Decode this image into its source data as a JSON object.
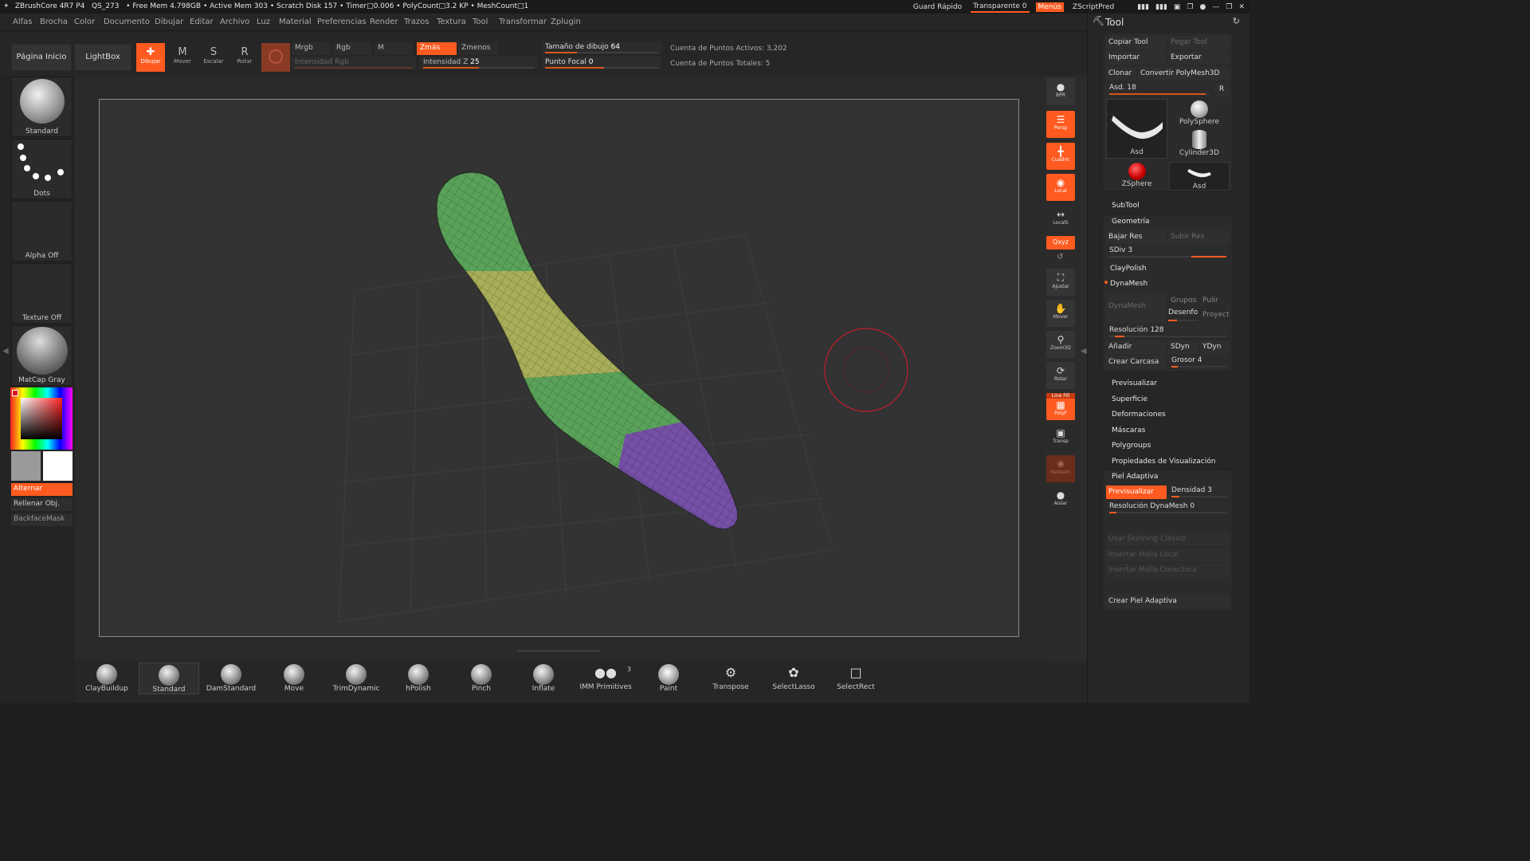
{
  "titlebar": {
    "app": "ZBrushCore 4R7 P4",
    "file": "QS_273",
    "free_mem": "• Free Mem 4.798GB",
    "active_mem": "• Active Mem 303",
    "scratch": "• Scratch Disk 157 •",
    "timer": "Timer□0.006",
    "polycount": "• PolyCount□3.2 KP",
    "meshcount": "• MeshCount□1",
    "quicksave": "Guard Rápido",
    "transparent": "Transparente 0",
    "menus": "Menús",
    "script": "ZScriptPred"
  },
  "menubar": [
    "Alfas",
    "Brocha",
    "Color",
    "Documento",
    "Dibujar",
    "Editar",
    "Archivo",
    "Luz",
    "Material",
    "Preferencias",
    "Render",
    "Trazos",
    "Textura",
    "Tool",
    "Transformar",
    "Zplugin"
  ],
  "shelf": {
    "home": "Página Inicio",
    "lightbox": "LightBox",
    "draw": "Dibujar",
    "move": "Mover",
    "scale": "Escalar",
    "rotate": "Rotar",
    "mrgb": "Mrgb",
    "rgb": "Rgb",
    "m": "M",
    "zadd": "Zmás",
    "zsub": "Zmenos",
    "rgb_intensity": "Intensidad Rgb",
    "z_intensity": "Intensidad Z",
    "z_intensity_value": "25",
    "draw_size": "Tamaño de dibujo",
    "draw_size_value": "64",
    "focal": "Punto Focal",
    "focal_value": "0",
    "active_points": "Cuenta de Puntos Activos: 3,202",
    "total_points": "Cuenta de Puntos Totales: 5"
  },
  "left": {
    "brush": "Standard",
    "stroke": "Dots",
    "alpha": "Alpha Off",
    "texture": "Texture Off",
    "material": "MatCap Gray",
    "alternate": "Alternar",
    "fill": "Rellenar Obj.",
    "backface": "BackfaceMask"
  },
  "rightbar": {
    "bpr": "BPR",
    "persp": "Persp",
    "floor": "Cuadric",
    "local": "Local",
    "locals": "LocalS",
    "xyz": "Qxyz",
    "frame": "Ajustar",
    "move": "Mover",
    "zoom": "Zoom3D",
    "rotate": "Rotar",
    "linefill": "Line Fill",
    "polyf": "PolyF",
    "transp": "Transp",
    "ghost": "Fantasm",
    "solo": "Aislar"
  },
  "brushes": [
    {
      "label": "ClayBuildup"
    },
    {
      "label": "Standard"
    },
    {
      "label": "DamStandard"
    },
    {
      "label": "Move"
    },
    {
      "label": "TrimDynamic"
    },
    {
      "label": "hPolish"
    },
    {
      "label": "Pinch"
    },
    {
      "label": "Inflate"
    },
    {
      "label": "IMM Primitives",
      "badge": "3"
    },
    {
      "label": "Paint"
    },
    {
      "label": "Transpose"
    },
    {
      "label": "SelectLasso"
    },
    {
      "label": "SelectRect"
    }
  ],
  "tool": {
    "title": "Tool",
    "copy": "Copiar Tool",
    "paste": "Pegar Tool",
    "import": "Importar",
    "export": "Exportar",
    "clone": "Clonar",
    "convert": "Convertir PolyMesh3D",
    "asd": "Asd.",
    "asd_value": "18",
    "r": "R",
    "thumbs": [
      "Asd",
      "PolySphere",
      "Cylinder3D",
      "ZSphere",
      "Asd"
    ],
    "subtool": "SubTool",
    "geometry": "Geometría",
    "lower_res": "Bajar Res",
    "higher_res": "Subir Res",
    "sdiv": "SDiv",
    "sdiv_value": "3",
    "claypolish": "ClayPolish",
    "dynamesh_header": "DynaMesh",
    "dynamesh_btn": "DynaMesh",
    "groups": "Grupos",
    "polish": "Pulir",
    "blur": "Desenfo",
    "project": "Proyect",
    "resolution": "Resolución",
    "resolution_value": "128",
    "add": "Añadir",
    "sdyn": "SDyn",
    "ydyn": "YDyn",
    "shell": "Crear Carcasa",
    "thickness": "Grosor",
    "thickness_value": "4",
    "sections": [
      "Previsualizar",
      "Superficie",
      "Deformaciones",
      "Máscaras",
      "Polygroups",
      "Propiedades de Visualización"
    ],
    "adaptive": "Piel Adaptiva",
    "preview": "Previsualizar",
    "density": "Densidad",
    "density_value": "3",
    "dynares": "Resolución DynaMesh",
    "dynares_value": "0",
    "classic": "Usar Skinning Clásico",
    "local_mesh": "Insertar Malla Local",
    "connector": "Insertar Malla Conectora",
    "make": "Crear Piel Adaptiva"
  },
  "colors": {
    "accent": "#ff5a1f",
    "seg_green": "#5aa25a",
    "seg_yellow": "#a8ad58",
    "seg_purple": "#7550a6"
  }
}
